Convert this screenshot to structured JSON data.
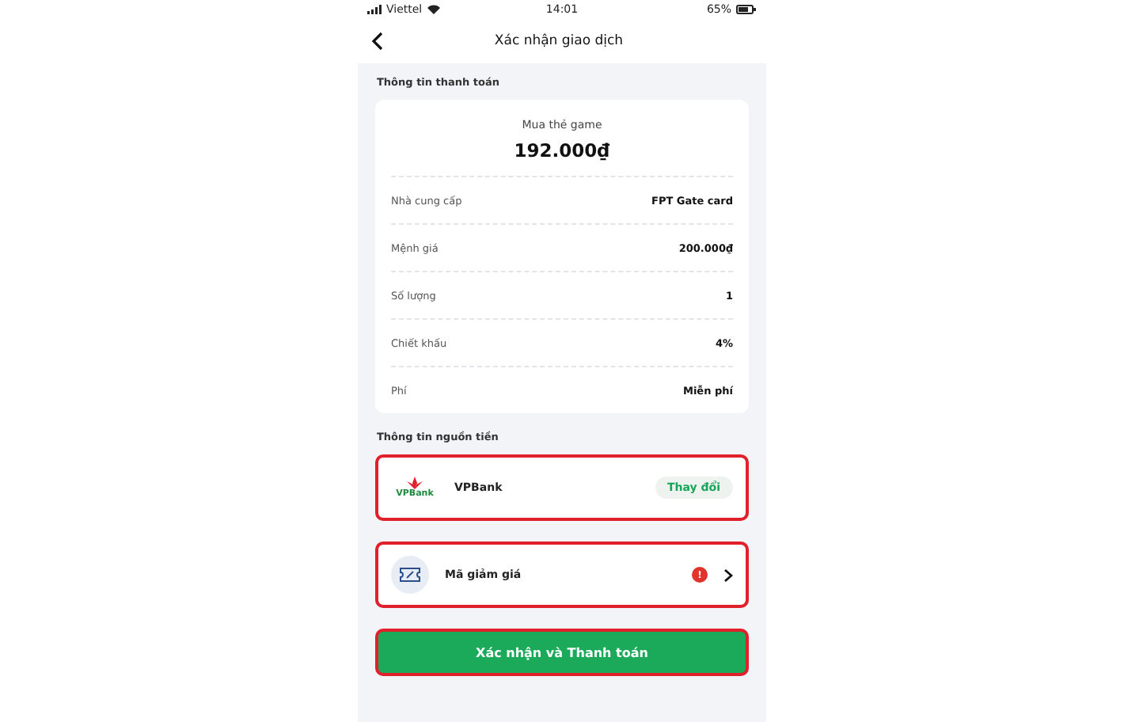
{
  "status_bar": {
    "carrier": "Viettel",
    "time": "14:01",
    "battery": "65%"
  },
  "header": {
    "title": "Xác nhận giao dịch"
  },
  "payment_info": {
    "heading": "Thông tin thanh toán",
    "product": "Mua thẻ game",
    "amount": "192.000₫",
    "rows": [
      {
        "label": "Nhà cung cấp",
        "value": "FPT Gate card"
      },
      {
        "label": "Mệnh giá",
        "value": "200.000₫"
      },
      {
        "label": "Số lượng",
        "value": "1"
      },
      {
        "label": "Chiết khấu",
        "value": "4%"
      },
      {
        "label": "Phí",
        "value": "Miễn phí"
      }
    ]
  },
  "funding_source": {
    "heading": "Thông tin nguồn tiền",
    "bank_logo_text": "VPBank",
    "bank_name": "VPBank",
    "change_button": "Thay đổi"
  },
  "voucher": {
    "label": "Mã giảm giá",
    "alert": "!"
  },
  "confirm_button": "Xác nhận và Thanh toán"
}
